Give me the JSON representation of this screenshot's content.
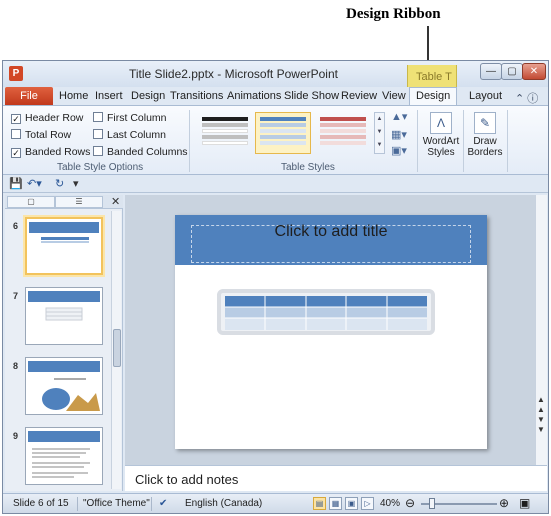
{
  "annotation": {
    "label": "Design Ribbon"
  },
  "window": {
    "title": "Title Slide2.pptx - Microsoft PowerPoint",
    "contextual_group": "Table T"
  },
  "tabs": {
    "file": "File",
    "items": [
      "Home",
      "Insert",
      "Design",
      "Transitions",
      "Animations",
      "Slide Show",
      "Review",
      "View"
    ],
    "design": "Design",
    "layout": "Layout"
  },
  "ribbon": {
    "style_options": {
      "caption": "Table Style Options",
      "header_row": {
        "label": "Header Row",
        "checked": true
      },
      "total_row": {
        "label": "Total Row",
        "checked": false
      },
      "banded_rows": {
        "label": "Banded Rows",
        "checked": true
      },
      "first_column": {
        "label": "First Column",
        "checked": false
      },
      "last_column": {
        "label": "Last Column",
        "checked": false
      },
      "banded_columns": {
        "label": "Banded Columns",
        "checked": false
      }
    },
    "table_styles": {
      "caption": "Table Styles",
      "thumbs": [
        {
          "header": "#1f1f1f",
          "band": "#bfbfbf"
        },
        {
          "header": "#4f81bd",
          "band": "#b8cce4"
        },
        {
          "header": "#c0504d",
          "band": "#e6b9b8"
        }
      ]
    },
    "wordart": {
      "label": "WordArt Styles"
    },
    "draw_borders": {
      "label": "Draw Borders"
    }
  },
  "slides_pane": {
    "numbers": [
      "6",
      "7",
      "8",
      "9"
    ]
  },
  "slide": {
    "title_placeholder": "Click to add title"
  },
  "notes": {
    "placeholder": "Click to add notes"
  },
  "status": {
    "slide_of": "Slide 6 of 15",
    "theme": "\"Office Theme\"",
    "language": "English (Canada)",
    "zoom": "40%"
  },
  "colors": {
    "accent": "#4f81bd",
    "file_tab": "#c1391c",
    "contextual": "#efe176"
  }
}
